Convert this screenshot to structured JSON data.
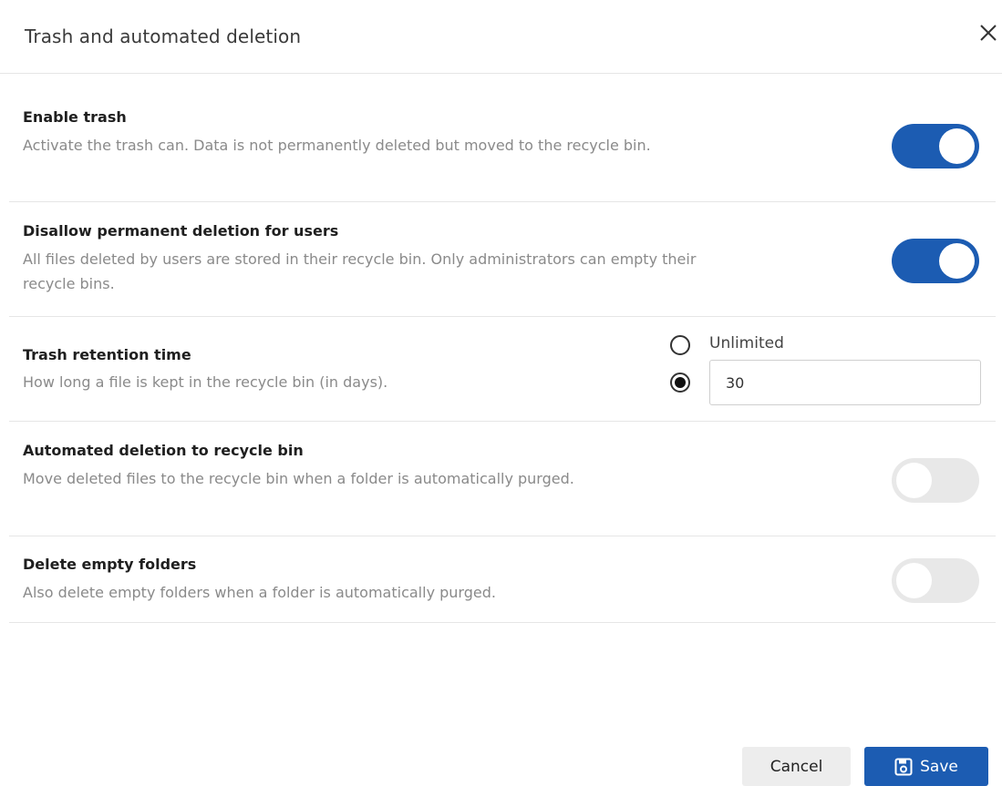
{
  "dialog": {
    "title": "Trash and automated deletion"
  },
  "settings": {
    "enable_trash": {
      "title": "Enable trash",
      "description": "Activate the trash can. Data is not permanently deleted but moved to the recycle bin.",
      "enabled": true
    },
    "disallow_permanent_deletion": {
      "title": "Disallow permanent deletion for users",
      "description": "All files deleted by users are stored in their recycle bin. Only administrators can empty their recycle bins.",
      "enabled": true
    },
    "retention": {
      "title": "Trash retention time",
      "description": "How long a file is kept in the recycle bin (in days).",
      "unlimited_label": "Unlimited",
      "selected": "days",
      "days_value": "30"
    },
    "automated_deletion": {
      "title": "Automated deletion to recycle bin",
      "description": "Move deleted files to the recycle bin when a folder is automatically purged.",
      "enabled": false
    },
    "delete_empty_folders": {
      "title": "Delete empty folders",
      "description": "Also delete empty folders when a folder is automatically purged.",
      "enabled": false
    }
  },
  "footer": {
    "cancel_label": "Cancel",
    "save_label": "Save"
  },
  "colors": {
    "accent": "#1c5cb2",
    "toggle_off": "#e8e8e8"
  },
  "icons": {
    "close": "close-icon",
    "save": "save-icon"
  }
}
